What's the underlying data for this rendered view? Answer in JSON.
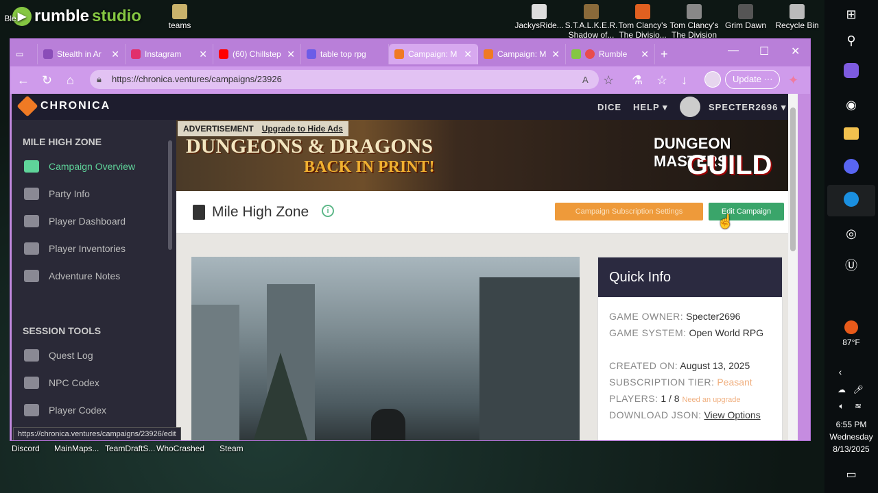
{
  "desktop": {
    "brand": {
      "rumble": "rumble",
      "studio": "studio"
    },
    "top_icons": [
      "Ble",
      "teams",
      "JackysRide...",
      "S.T.A.L.K.E.R. Shadow of...",
      "Tom Clancy's The Divisio...",
      "Tom Clancy's The Division",
      "Grim Dawn",
      "Recycle Bin"
    ],
    "bottom_icons": [
      "Discord",
      "MainMaps...",
      "TeamDraftS...",
      "WhoCrashed",
      "Steam"
    ]
  },
  "taskbar": {
    "weather": "87°F",
    "time": "6:55 PM",
    "day": "Wednesday",
    "date": "8/13/2025"
  },
  "browser": {
    "tabs": [
      {
        "label": "Stealth in Ar",
        "color": "#8a4db8"
      },
      {
        "label": "Instagram",
        "color": "#e1306c"
      },
      {
        "label": "(60) Chillstep",
        "color": "#ff0000"
      },
      {
        "label": "table top rpg",
        "color": "#6c5ce7"
      },
      {
        "label": "Campaign: M",
        "color": "#f07a24"
      },
      {
        "label": "Campaign: M",
        "color": "#f07a24"
      },
      {
        "label": "Rumble",
        "color": "#85c742"
      }
    ],
    "url": "https://chronica.ventures/campaigns/23926",
    "update_label": "Update"
  },
  "site": {
    "logo": "CHRONICA",
    "nav": {
      "dice": "DICE",
      "help": "HELP ▾",
      "user": "SPECTER2696 ▾"
    },
    "status_url": "https://chronica.ventures/campaigns/23926/edit"
  },
  "sidebar": {
    "section1": "MILE HIGH ZONE",
    "items": [
      {
        "label": "Campaign Overview"
      },
      {
        "label": "Party Info"
      },
      {
        "label": "Player Dashboard"
      },
      {
        "label": "Player Inventories"
      },
      {
        "label": "Adventure Notes"
      }
    ],
    "section2": "SESSION TOOLS",
    "tools": [
      {
        "label": "Quest Log"
      },
      {
        "label": "NPC Codex"
      },
      {
        "label": "Player Codex"
      }
    ]
  },
  "ad": {
    "label": "ADVERTISEMENT",
    "upgrade": "Upgrade to Hide Ads",
    "headline": "DUNGEONS & DRAGONS",
    "sub": "BACK IN PRINT!",
    "brand1": "DUNGEON MASTERS",
    "brand2": "GUILD"
  },
  "campaign": {
    "title": "Mile High Zone",
    "subscription_btn": "Campaign Subscription Settings",
    "edit_btn": "Edit Campaign"
  },
  "quick_info": {
    "heading": "Quick Info",
    "owner_label": "GAME OWNER:",
    "owner": "Specter2696",
    "system_label": "GAME SYSTEM:",
    "system": "Open World RPG",
    "created_label": "CREATED ON:",
    "created": "August 13, 2025",
    "tier_label": "SUBSCRIPTION TIER:",
    "tier": "Peasant",
    "players_label": "PLAYERS:",
    "players": "1 / 8",
    "players_note": "Need an upgrade",
    "download_label": "DOWNLOAD JSON:",
    "download": "View Options"
  }
}
